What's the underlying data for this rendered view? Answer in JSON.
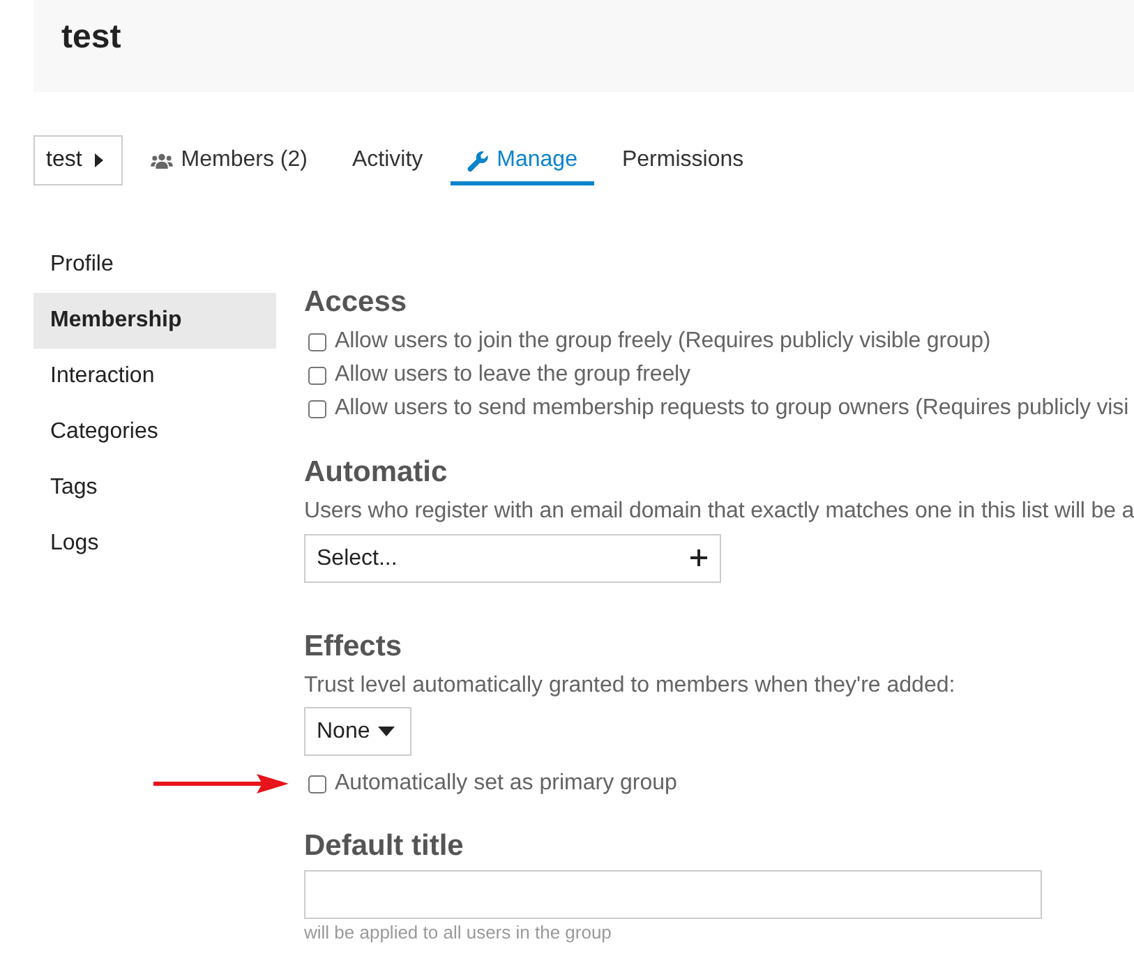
{
  "header": {
    "title": "test"
  },
  "nav": {
    "group_menu": {
      "label": "test"
    },
    "tabs": [
      {
        "label": "Members (2)",
        "kind": "members",
        "selected": false
      },
      {
        "label": "Activity",
        "kind": "plain",
        "selected": false
      },
      {
        "label": "Manage",
        "kind": "manage",
        "selected": true
      },
      {
        "label": "Permissions",
        "kind": "plain",
        "selected": false
      }
    ]
  },
  "sidebar": {
    "items": [
      {
        "label": "Profile",
        "selected": false
      },
      {
        "label": "Membership",
        "selected": true
      },
      {
        "label": "Interaction",
        "selected": false
      },
      {
        "label": "Categories",
        "selected": false
      },
      {
        "label": "Tags",
        "selected": false
      },
      {
        "label": "Logs",
        "selected": false
      }
    ]
  },
  "access": {
    "heading": "Access",
    "options": [
      {
        "label": "Allow users to join the group freely (Requires publicly visible group)",
        "checked": false
      },
      {
        "label": "Allow users to leave the group freely",
        "checked": false
      },
      {
        "label": "Allow users to send membership requests to group owners (Requires publicly visi",
        "checked": false
      }
    ]
  },
  "automatic": {
    "heading": "Automatic",
    "description": "Users who register with an email domain that exactly matches one in this list will be a",
    "email_domains": {
      "placeholder": "Select..."
    }
  },
  "effects": {
    "heading": "Effects",
    "trust_level_label": "Trust level automatically granted to members when they're added:",
    "trust_level": {
      "value": "None"
    },
    "primary_group": {
      "label": "Automatically set as primary group",
      "checked": false
    }
  },
  "default_title": {
    "heading": "Default title",
    "hint": "will be applied to all users in the group"
  }
}
